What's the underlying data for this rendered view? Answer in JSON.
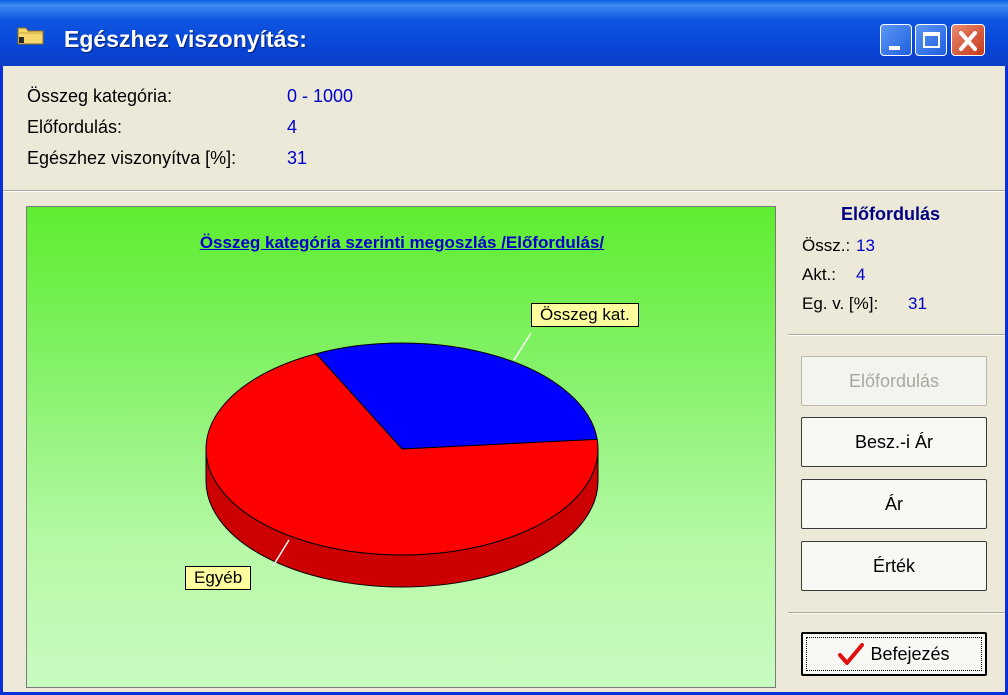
{
  "window": {
    "title": "Egészhez viszonyítás:"
  },
  "info": {
    "category_label": "Összeg kategória:",
    "category_value": "0 - 1000",
    "occurrence_label": "Előfordulás:",
    "occurrence_value": "4",
    "percent_label": "Egészhez viszonyítva [%]:",
    "percent_value": "31"
  },
  "chart_data": {
    "type": "pie",
    "title": "Összeg kategória szerinti megoszlás /Előfordulás/",
    "slices": [
      {
        "label": "Összeg kat.",
        "value": 4,
        "color": "#0000ff"
      },
      {
        "label": "Egyéb",
        "value": 9,
        "color": "#ff0000"
      }
    ]
  },
  "stats": {
    "heading": "Előfordulás",
    "total_label": "Össz.:",
    "total_value": "13",
    "current_label": "Akt.:",
    "current_value": "4",
    "percent_label": "Eg. v. [%]:",
    "percent_value": "31"
  },
  "buttons": {
    "occurrence": "Előfordulás",
    "purchase_price": "Besz.-i Ár",
    "price": "Ár",
    "value": "Érték",
    "finish": "Befejezés"
  },
  "colors": {
    "background_top": "#5ded2f",
    "background_bottom": "#c8fbc0",
    "callout": "#ffffa0"
  }
}
